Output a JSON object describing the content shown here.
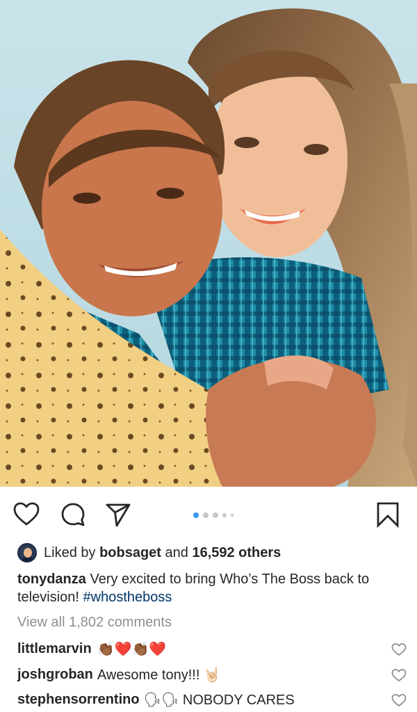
{
  "post": {
    "image_alt": "Photo of a smiling man hugging a smiling young woman"
  },
  "actions": {
    "like_icon": "heart-outline-icon",
    "comment_icon": "speech-bubble-icon",
    "share_icon": "paper-plane-icon",
    "save_icon": "bookmark-icon",
    "carousel_active_index": 0,
    "carousel_count": 5
  },
  "likes": {
    "prefix": "Liked by ",
    "user": "bobsaget",
    "middle": " and ",
    "count": "16,592 others"
  },
  "caption": {
    "username": "tonydanza",
    "text": " Very excited to bring Who’s The Boss back to television! ",
    "hashtag": "#whostheboss"
  },
  "view_all": "View all 1,802 comments",
  "comments": [
    {
      "username": "littlemarvin",
      "text": "👏🏾❤️👏🏾❤️"
    },
    {
      "username": "joshgroban",
      "text": "Awesome tony!!! 🤘🏻"
    },
    {
      "username": "stephensorrentino",
      "text": "🗣🗣 NOBODY CARES"
    }
  ],
  "colors": {
    "hashtag": "#003569",
    "carousel_active": "#3897f0",
    "muted": "#8e8e8e"
  }
}
